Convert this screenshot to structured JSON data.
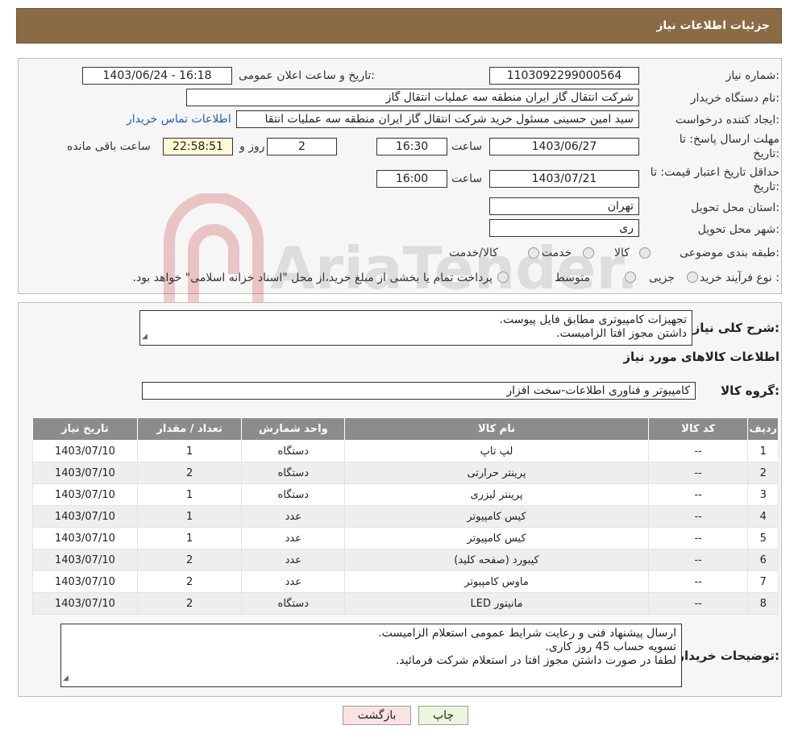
{
  "header": {
    "title": "جزئیات اطلاعات نیاز"
  },
  "form": {
    "need_number_label": "شماره نیاز:",
    "need_number": "1103092299000564",
    "announce_label": "تاریخ و ساعت اعلان عمومی:",
    "announce_value": "1403/06/24 - 16:18",
    "buyer_org_label": "نام دستگاه خریدار:",
    "buyer_org": "شرکت انتقال گاز ایران منطقه سه عملیات انتقال گاز",
    "creator_label": "ایجاد کننده درخواست:",
    "creator": "سید امین حسینی مسئول خرید شرکت انتقال گاز ایران منطقه سه عملیات انتقا",
    "contact_link": "اطلاعات تماس خریدار",
    "deadline_label_1": "مهلت ارسال پاسخ: تا",
    "deadline_label_2": "تاریخ:",
    "deadline_date": "1403/06/27",
    "time_label": "ساعت",
    "deadline_time": "16:30",
    "days_value": "2",
    "days_label": "روز و",
    "remaining_time": "22:58:51",
    "remaining_label": "ساعت باقی مانده",
    "validity_label_1": "حداقل تاریخ اعتبار قیمت: تا",
    "validity_label_2": "تاریخ:",
    "validity_date": "1403/07/21",
    "validity_time": "16:00",
    "province_label": "استان محل تحویل:",
    "province": "تهران",
    "city_label": "شهر محل تحویل:",
    "city": "ری",
    "category_label": "طبقه بندی موضوعی:",
    "category_options": [
      "کالا",
      "خدمت",
      "کالا/خدمت"
    ],
    "process_label": "نوع فرآیند خرید :",
    "process_options": [
      "جزیی",
      "متوسط"
    ],
    "process_note": "پرداخت تمام یا بخشی از مبلغ خرید،از محل \"اسناد خزانه اسلامی\" خواهد بود."
  },
  "watermark": {
    "text": "AriaTender.neT"
  },
  "summary": {
    "label": "شرح کلی نیاز:",
    "lines": [
      "تجهیزات کامپیوتری مطابق فایل پیوست.",
      "داشتن مجوز افتا الزامیست."
    ]
  },
  "goods_info": {
    "title": "اطلاعات کالاهای مورد نیاز",
    "group_label": "گروه کالا:",
    "group_value": "کامپیوتر و فناوری اطلاعات-سخت افزار"
  },
  "table": {
    "headers": [
      "ردیف",
      "کد کالا",
      "نام کالا",
      "واحد شمارش",
      "تعداد / مقدار",
      "تاریخ نیاز"
    ],
    "rows": [
      [
        "1",
        "--",
        "لپ تاپ",
        "دستگاه",
        "1",
        "1403/07/10"
      ],
      [
        "2",
        "--",
        "پرینتر حرارتی",
        "دستگاه",
        "2",
        "1403/07/10"
      ],
      [
        "3",
        "--",
        "پرینتر لیزری",
        "دستگاه",
        "1",
        "1403/07/10"
      ],
      [
        "4",
        "--",
        "کیس کامپیوتر",
        "عدد",
        "1",
        "1403/07/10"
      ],
      [
        "5",
        "--",
        "کیس کامپیوتر",
        "عدد",
        "1",
        "1403/07/10"
      ],
      [
        "6",
        "--",
        "کیبورد (صفحه کلید)",
        "عدد",
        "2",
        "1403/07/10"
      ],
      [
        "7",
        "--",
        "ماوس کامپیوتر",
        "عدد",
        "2",
        "1403/07/10"
      ],
      [
        "8",
        "--",
        "مانیتور LED",
        "دستگاه",
        "2",
        "1403/07/10"
      ]
    ]
  },
  "buyer_notes": {
    "label": "توضیحات خریدار:",
    "lines": [
      "ارسال پیشنهاد فنی و رعایت شرایط عمومی استعلام الزامیست.",
      "تسویه حساب 45 روز کاری.",
      "لطفا در صورت داشتن مجوز افتا در استعلام شرکت فرمائید."
    ]
  },
  "buttons": {
    "print": "چاپ",
    "back": "بازگشت"
  },
  "colors": {
    "header_bg": "#8a6b45",
    "table_header_bg": "#8c8c8c",
    "link": "#1d5fb3"
  }
}
